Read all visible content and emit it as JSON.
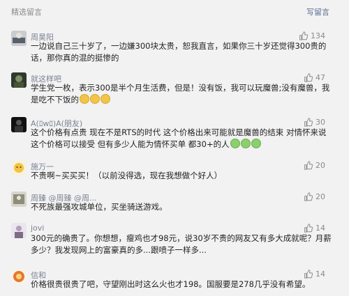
{
  "header": {
    "title": "精选留言",
    "write": "写留言"
  },
  "comments": [
    {
      "name": "周昊阳",
      "likes": "134",
      "text": "一边说自己三十岁了，一边嫌300块太贵，恕我直言，如果你三十岁还觉得300贵的话，那你真的混的挺惨的"
    },
    {
      "name": "就这样吧",
      "likes": "47",
      "text": "学生党一枚，表示300是半个月生活费，但是！没有饭，我可以玩魔兽;没有魔兽，我是吃不下饭的"
    },
    {
      "name": "A(ﾛwﾛ)A(朋友)",
      "likes": "30",
      "text": "这个价格有点贵 现在不是RTS的时代 这个价格出来可能就是魔兽的结束  对情怀来说这个价格可以接受 但有多少人能为情怀买单 都30+的人"
    },
    {
      "name": "施万一",
      "likes": "20",
      "text": "不贵啊~买买买！（以前没得选，现在我想做个好人）"
    },
    {
      "name": "周臻 @周臻 @周...",
      "likes": "20",
      "text": "不死族最强攻城单位，买坐骑送游戏。"
    },
    {
      "name": "jovi",
      "likes": "14",
      "text": "300元的确贵了。你想想，瘦鸡也才98元，说30岁不贵的网友又有多大成就呢？月薪多少？我发现网上的富豪真的多...跟喷子一样多..."
    },
    {
      "name": "信和",
      "likes": "14",
      "text": "价格很贵很贵了吧，守望刚出时这么火也才198。国服要是278几乎没有希望。"
    }
  ]
}
